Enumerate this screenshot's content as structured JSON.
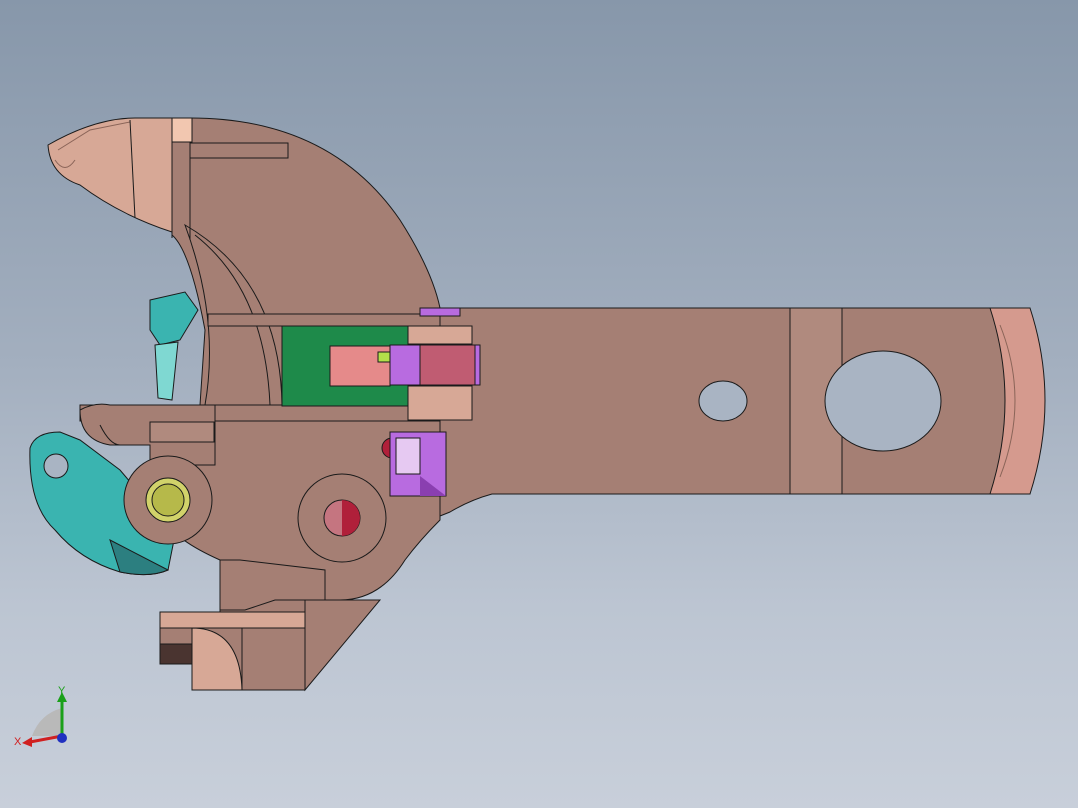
{
  "app": {
    "view": "cad-3d-viewport",
    "model_description_shown": false
  },
  "triad": {
    "x_label": "X",
    "y_label": "Y",
    "colors": {
      "x": "#d02020",
      "y": "#1aa01a",
      "z": "#2030c0"
    }
  },
  "colors": {
    "background_top": "#8797aa",
    "background_bottom": "#c8cfda",
    "main_body": "#a57f74",
    "light_part": "#d7a896",
    "dark_outline": "#1a1a1a",
    "teal_part": "#3ab4b0",
    "dark_teal": "#2c7f80",
    "green_part": "#1e8a4a",
    "pink_part": "#e58a8a",
    "purple_part": "#b86be0",
    "crimson_hole": "#b0203a",
    "yellow_pin": "#b6b94a"
  }
}
